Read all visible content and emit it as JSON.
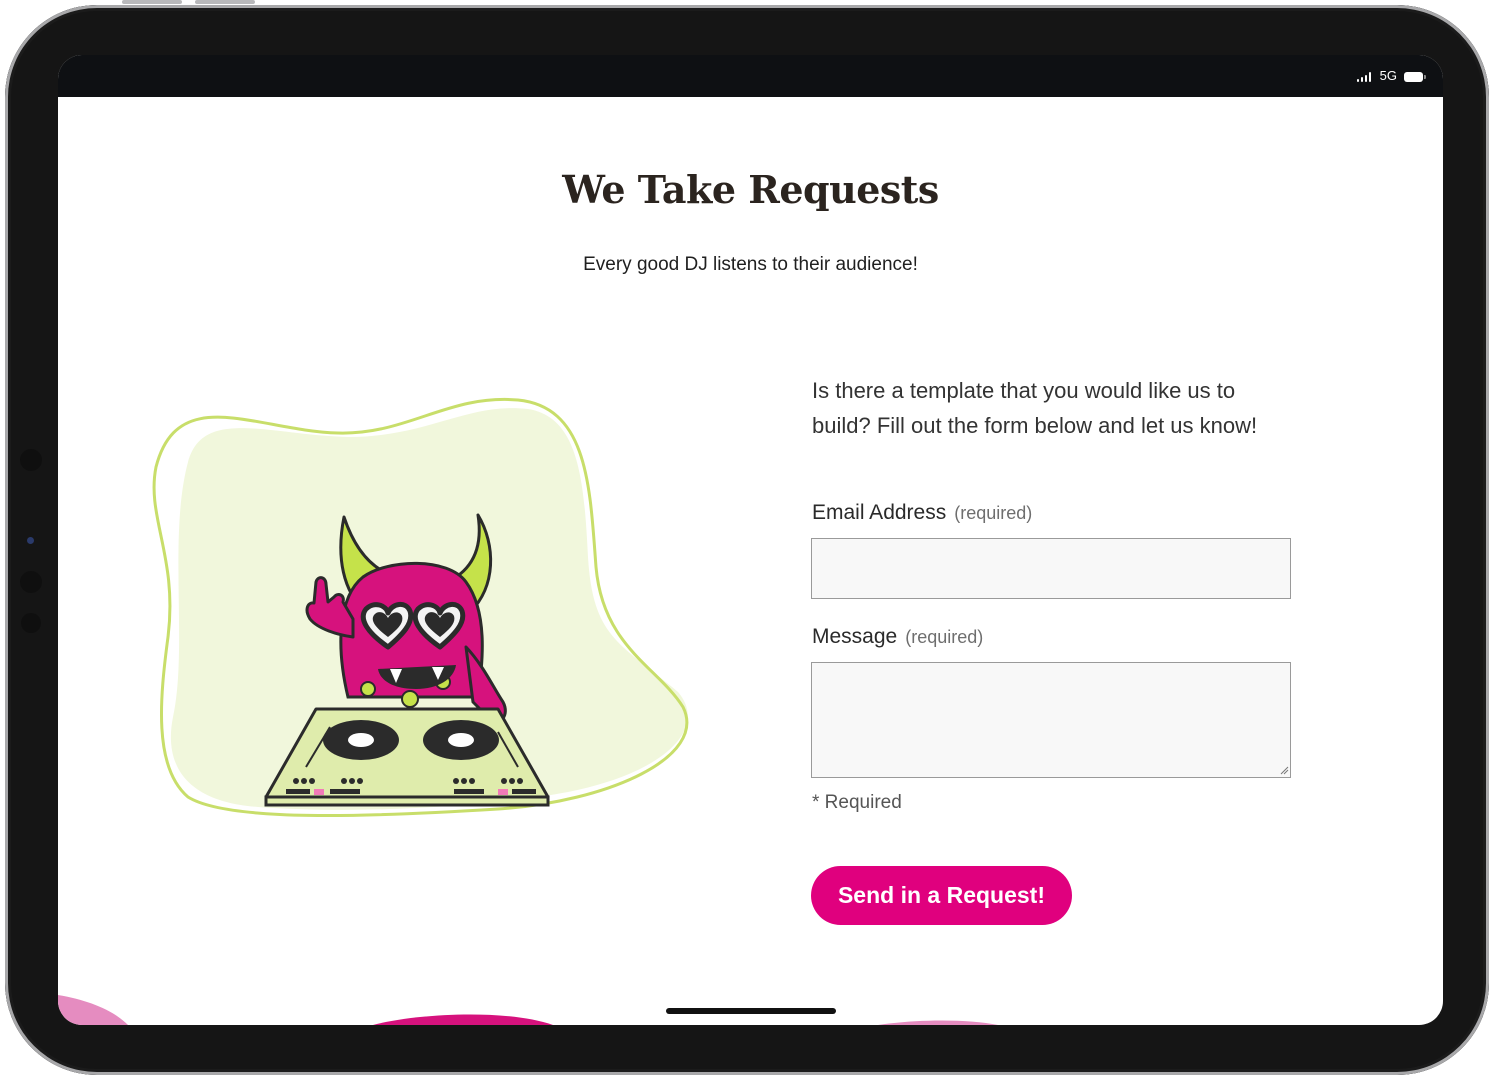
{
  "status_bar": {
    "network": "5G"
  },
  "page": {
    "title": "We Take Requests",
    "subtitle": "Every good DJ listens to their audience!"
  },
  "form": {
    "intro": "Is there a template that you would like us to build? Fill out the form below and let us know!",
    "email_label": "Email Address",
    "email_required": "(required)",
    "email_value": "",
    "message_label": "Message",
    "message_required": "(required)",
    "message_value": "",
    "required_note": "* Required",
    "submit_label": "Send in a Request!"
  },
  "colors": {
    "accent": "#e0007e",
    "monster": "#d6127d",
    "horns": "#c5e24a",
    "blob_fill": "#f1f7dc",
    "blob_outline": "#c8de6a",
    "deck": "#dfecac"
  },
  "icons": {
    "signal": "signal-bars-icon",
    "battery": "battery-icon",
    "illustration": "dj-monster-illustration"
  }
}
